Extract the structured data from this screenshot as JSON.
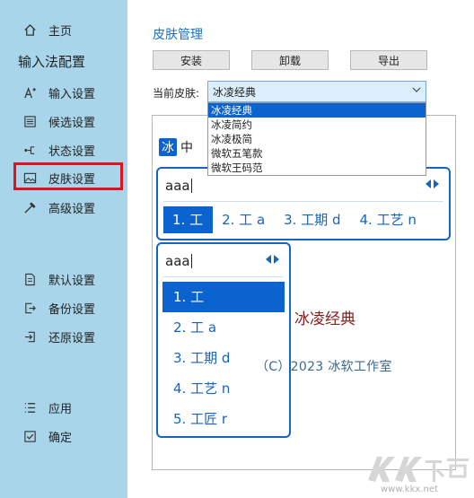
{
  "sidebar": {
    "home_label": "主页",
    "section_title": "输入法配置",
    "items": [
      {
        "label": "输入设置"
      },
      {
        "label": "候选设置"
      },
      {
        "label": "状态设置"
      },
      {
        "label": "皮肤设置"
      },
      {
        "label": "高级设置"
      },
      {
        "label": "默认设置"
      },
      {
        "label": "备份设置"
      },
      {
        "label": "还原设置"
      },
      {
        "label": "应用"
      },
      {
        "label": "确定"
      }
    ],
    "selected": "皮肤设置",
    "highlight_color": "#e0101e",
    "bg_color": "#a9d5ea"
  },
  "main": {
    "title": "皮肤管理",
    "buttons": {
      "install": "安装",
      "uninstall": "卸载",
      "export": "导出"
    },
    "skin_label": "当前皮肤:",
    "select_value": "冰凌经典",
    "dropdown_options": [
      "冰凌经典",
      "冰凌简约",
      "冰凌极简",
      "微软五笔款",
      "微软王码范"
    ],
    "dropdown_selected": "冰凌经典"
  },
  "preview": {
    "status_icon_text": "冰",
    "status_mode": "中",
    "composition": "aaa",
    "horizontal_candidates": [
      "1. 工",
      "2. 工 a",
      "3. 工期 d",
      "4. 工艺 n"
    ],
    "vertical_candidates": [
      "1. 工",
      "2. 工 a",
      "3. 工期 d",
      "4. 工艺 n",
      "5. 工匠 r"
    ],
    "skin_name": "冰凌经典",
    "copyright": "（C）2023 冰软工作室"
  },
  "watermark": {
    "text": "www.kkx.net"
  }
}
